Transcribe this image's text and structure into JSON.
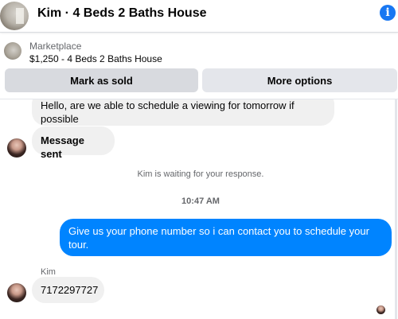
{
  "header": {
    "title": "Kim · 4 Beds 2 Baths House",
    "info_icon": "info-icon",
    "info_glyph": "i"
  },
  "listing": {
    "source": "Marketplace",
    "title": "$1,250 - 4 Beds 2 Baths House",
    "mark_sold_label": "Mark as sold",
    "more_options_label": "More options"
  },
  "messages": [
    {
      "from": "Kim",
      "text": "Hello, are we able to schedule a viewing for tomorrow if possible"
    },
    {
      "from": "Kim",
      "text": "Message sent"
    }
  ],
  "waiting_text": "Kim is waiting for your response.",
  "timestamp": "10:47 AM",
  "reply": {
    "text": "Give us your phone number so i can contact you to schedule your tour."
  },
  "sender_name": "Kim",
  "last_message": {
    "from": "Kim",
    "text": "7172297727"
  },
  "colors": {
    "accent": "#1877f2",
    "outgoing_bubble": "#0084ff",
    "incoming_bubble": "#f0f0f0"
  }
}
